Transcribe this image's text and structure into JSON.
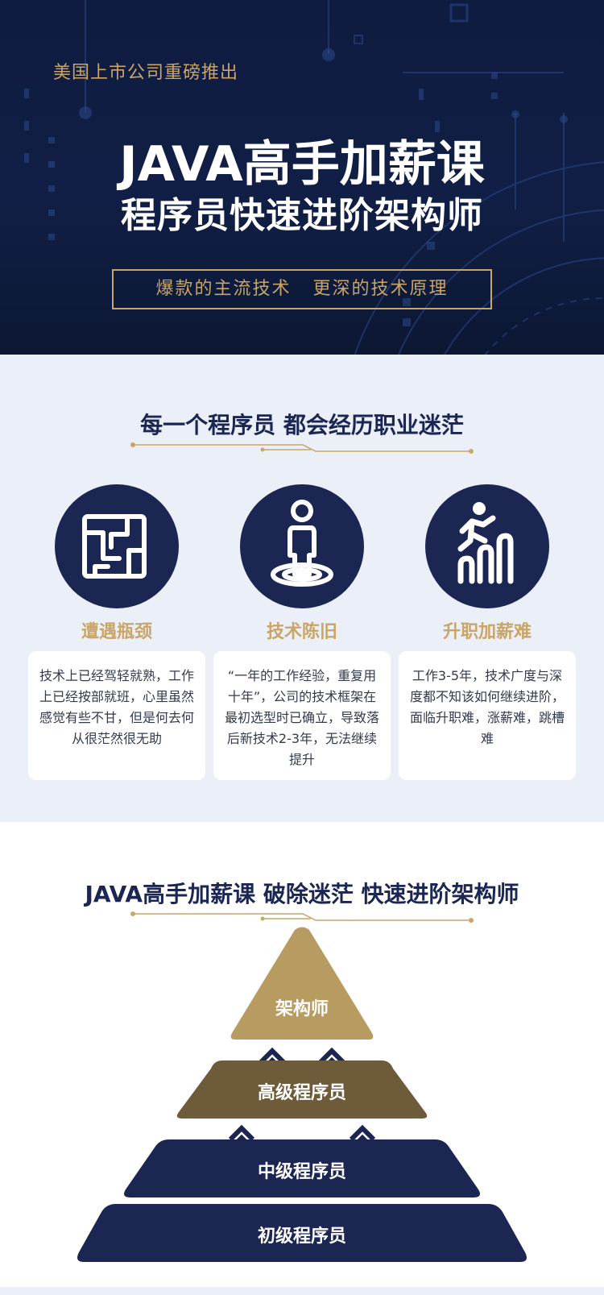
{
  "hero": {
    "tagline": "美国上市公司重磅推出",
    "title": "JAVA高手加薪课",
    "subtitle": "程序员快速进阶架构师",
    "banner": "爆款的主流技术   更深的技术原理",
    "colors": {
      "background": "#0f1b3f",
      "accent": "#c9a567"
    }
  },
  "section_confusion": {
    "title": "每一个程序员 都会经历职业迷茫",
    "cards": [
      {
        "icon": "maze-icon",
        "title": "遭遇瓶颈",
        "text": "技术上已经驾轻就熟，工作上已经按部就班，心里虽然感觉有些不甘，但是何去何从很茫然很无助"
      },
      {
        "icon": "stuck-person-icon",
        "title": "技术陈旧",
        "text": "“一年的工作经验，重复用十年”，公司的技术框架在最初选型时已确立，导致落后新技术2-3年，无法继续提升"
      },
      {
        "icon": "climbing-bars-icon",
        "title": "升职加薪难",
        "text": "工作3-5年，技术广度与深度都不知该如何继续进阶，面临升职难，涨薪难，跳槽难"
      }
    ]
  },
  "section_path": {
    "title": "JAVA高手加薪课 破除迷茫 快速进阶架构师",
    "levels": [
      "架构师",
      "高级程序员",
      "中级程序员",
      "初级程序员"
    ],
    "colors": {
      "top": "#b89b60",
      "second": "#6e5b3a",
      "lower": "#1b2653"
    }
  }
}
